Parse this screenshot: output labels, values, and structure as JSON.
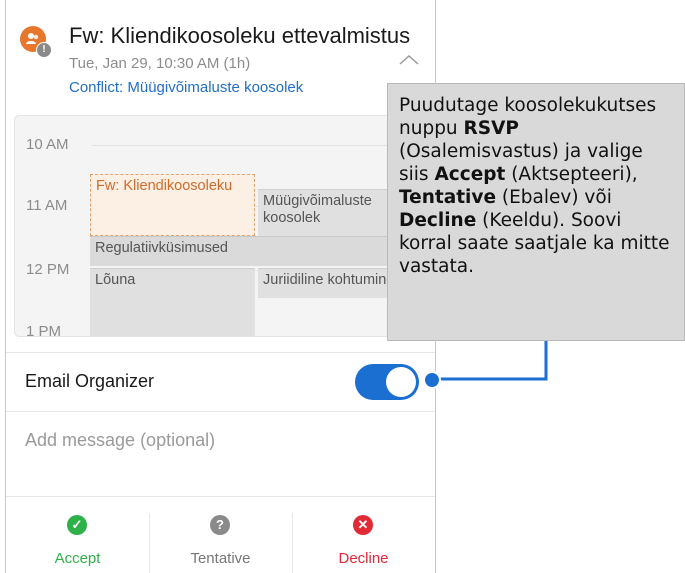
{
  "event": {
    "title": "Fw: Kliendikoosoleku ettevalmistus",
    "datetime": "Tue, Jan 29, 10:30 AM (1h)",
    "conflict": "Conflict: Müügivõimaluste koosolek",
    "badge": "!"
  },
  "calendar": {
    "times": [
      "10 AM",
      "11 AM",
      "12 PM",
      "1 PM"
    ],
    "events": {
      "selected": "Fw: Kliendikoosoleku",
      "conflict": "Müügivõimaluste koosolek",
      "reg": "Regulatiivküsimused",
      "lunch": "Lõuna",
      "legal": "Juriidiline kohtumine"
    }
  },
  "email_organizer": {
    "label": "Email Organizer",
    "enabled": true
  },
  "message": {
    "placeholder": "Add message (optional)"
  },
  "actions": {
    "accept": {
      "label": "Accept",
      "icon": "check-icon",
      "color": "#2fb14a"
    },
    "tentative": {
      "label": "Tentative",
      "icon": "question-icon",
      "color": "#8a8a8a"
    },
    "decline": {
      "label": "Decline",
      "icon": "x-icon",
      "color": "#e02b36"
    }
  },
  "callout": {
    "t1": "Puudutage koosolekukutses nuppu ",
    "b1": "RSVP",
    "t2": " (Osalemisvastus) ja valige siis ",
    "b2": "Accept",
    "t3": " (Aktsepteeri), ",
    "b3": "Tentative",
    "t4": " (Ebalev) või ",
    "b4": "Decline",
    "t5": " (Keeldu). Soovi korral saate saatjale ka mitte vastata."
  },
  "colors": {
    "accent": "#1a6fd1",
    "link": "#1f6fc9",
    "avatar": "#e8772e",
    "callout_line": "#1a6fd1"
  }
}
